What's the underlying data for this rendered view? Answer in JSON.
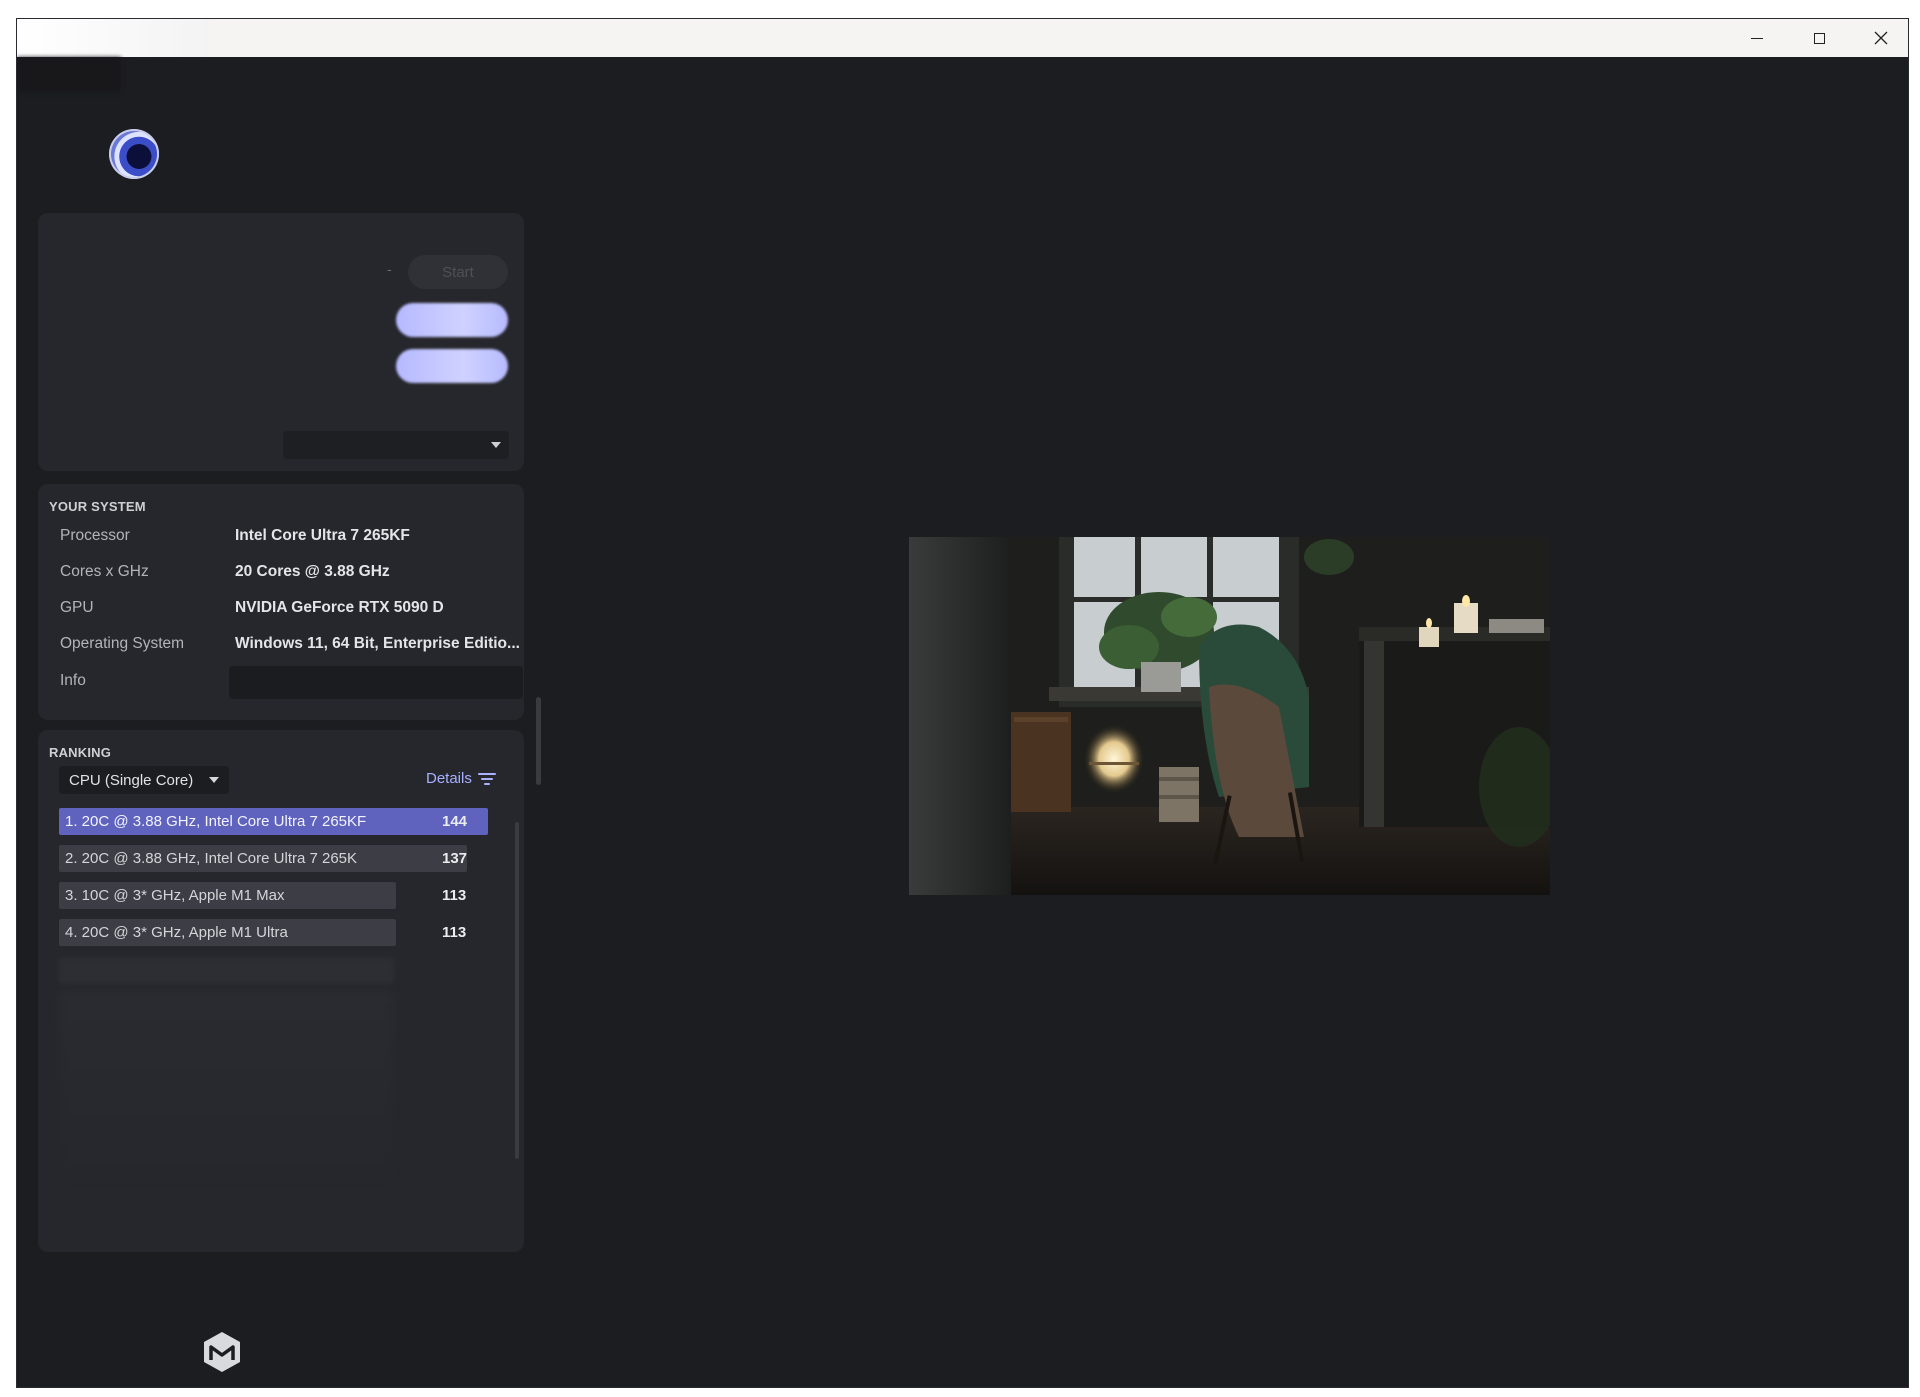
{
  "window": {
    "controls": {
      "minimize": "minimize",
      "maximize": "maximize",
      "close": "close"
    }
  },
  "controls_panel": {
    "start_label": "Start",
    "separator": "-"
  },
  "system": {
    "title": "YOUR SYSTEM",
    "rows": [
      {
        "label": "Processor",
        "value": "Intel Core Ultra 7 265KF"
      },
      {
        "label": "Cores x GHz",
        "value": "20 Cores @ 3.88 GHz"
      },
      {
        "label": "GPU",
        "value": "NVIDIA GeForce RTX 5090 D"
      },
      {
        "label": "Operating System",
        "value": "Windows 11, 64 Bit, Enterprise Editio..."
      },
      {
        "label": "Info",
        "value": ""
      }
    ]
  },
  "ranking": {
    "title": "RANKING",
    "mode": "CPU (Single Core)",
    "details_label": "Details",
    "entries": [
      {
        "label": "1. 20C @ 3.88 GHz, Intel Core Ultra 7 265KF",
        "score": "144",
        "relative": 1.0,
        "selected": true
      },
      {
        "label": "2. 20C @ 3.88 GHz, Intel Core Ultra 7 265K",
        "score": "137",
        "relative": 0.95,
        "selected": false
      },
      {
        "label": "3. 10C @ 3* GHz, Apple M1 Max",
        "score": "113",
        "relative": 0.785,
        "selected": false
      },
      {
        "label": "4. 20C @ 3* GHz, Apple M1 Ultra",
        "score": "113",
        "relative": 0.785,
        "selected": false
      }
    ]
  },
  "colors": {
    "background": "#1c1d21",
    "panel": "#26272c",
    "accent": "#5f63be",
    "link": "#a9b0ff"
  },
  "icons": {
    "app_logo": "cinebench-sphere-icon",
    "footer_logo": "maxon-logo-icon",
    "details": "filter-icon"
  }
}
